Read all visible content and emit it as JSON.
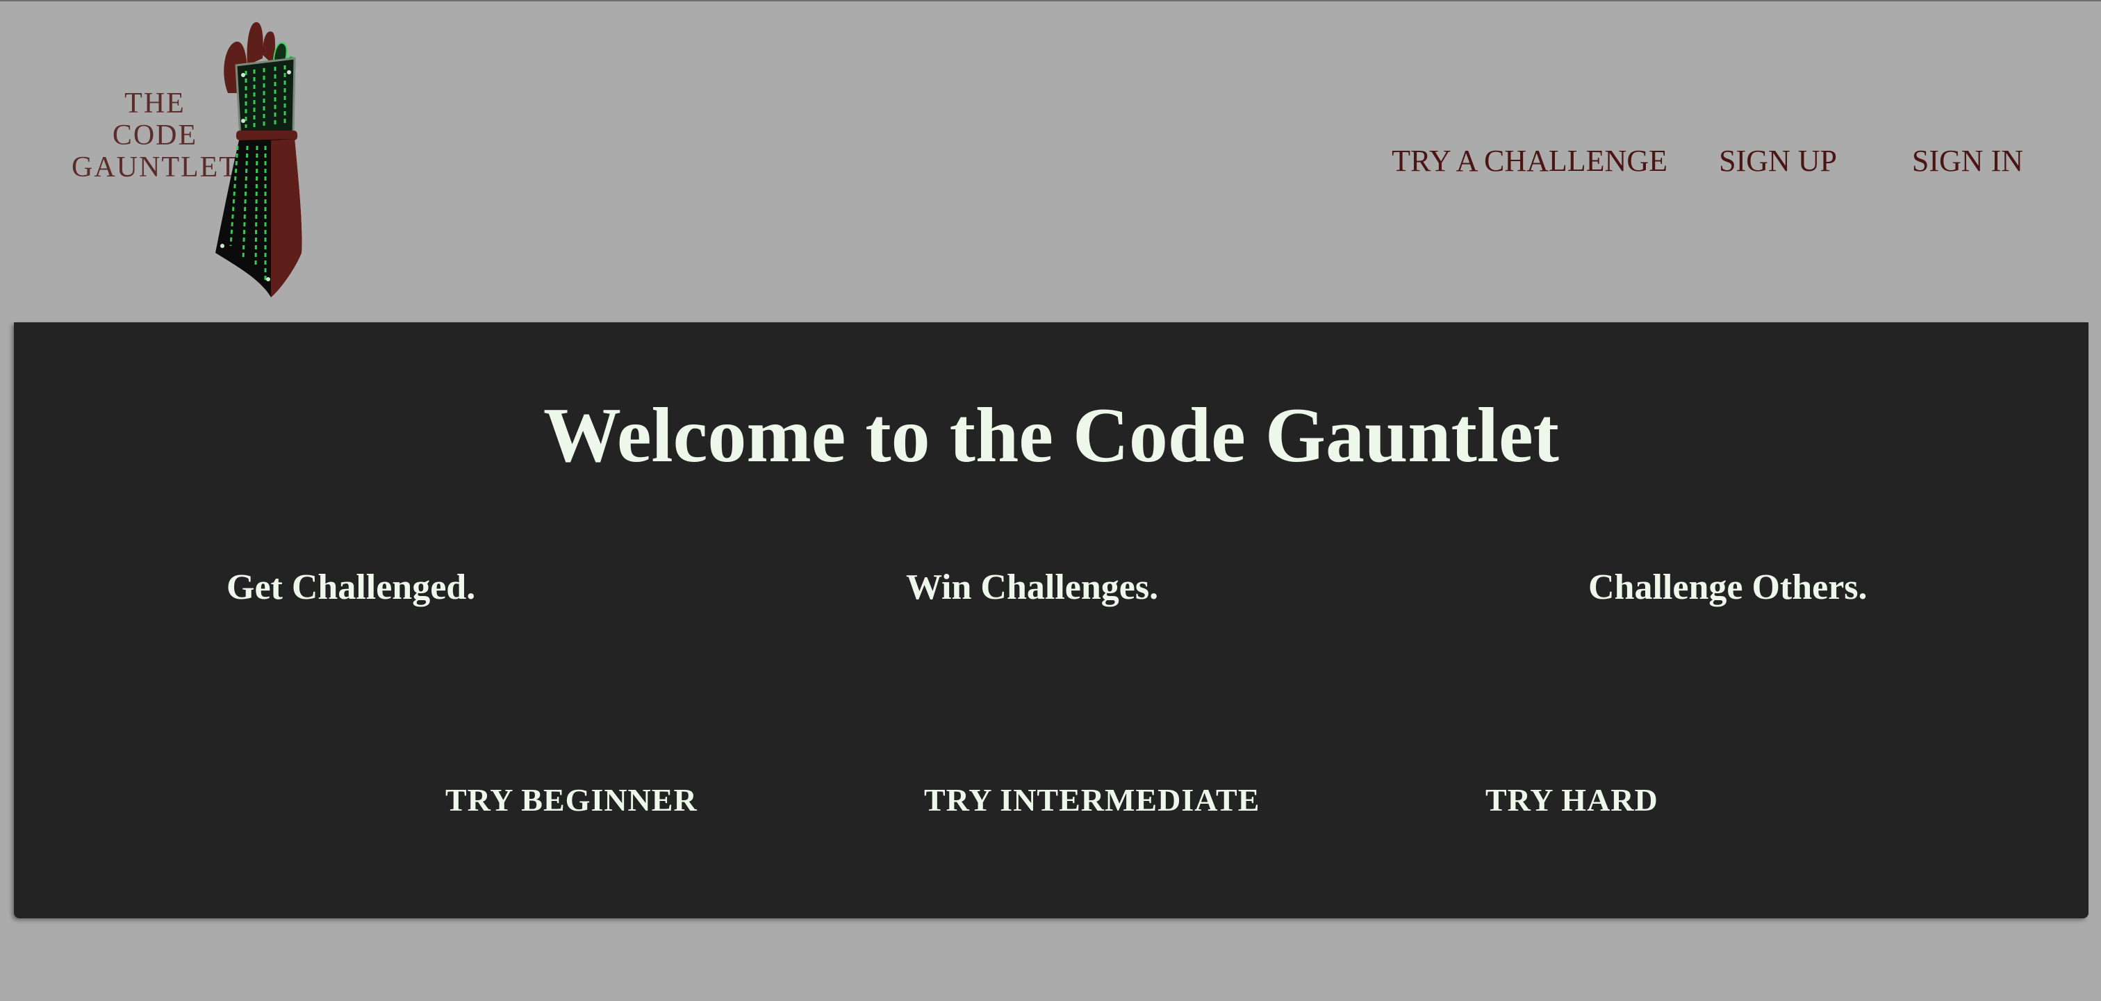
{
  "header": {
    "logo": {
      "line1": "THE",
      "line2": "CODE",
      "line3": "GAUNTLET",
      "icon": "gauntlet-icon"
    },
    "nav": {
      "try_challenge": "TRY A CHALLENGE",
      "sign_up": "SIGN UP",
      "sign_in": "SIGN IN"
    }
  },
  "hero": {
    "title": "Welcome to the Code Gauntlet",
    "taglines": {
      "get": "Get Challenged.",
      "win": "Win Challenges.",
      "others": "Challenge Others."
    },
    "buttons": {
      "beginner": "TRY BEGINNER",
      "intermediate": "TRY INTERMEDIATE",
      "hard": "TRY HARD"
    }
  },
  "colors": {
    "page_background": "#ababab",
    "hero_background": "#232324",
    "hero_text": "#eef8ea",
    "nav_text": "#4a1512",
    "logo_text": "#5a2d2b",
    "gauntlet_brown": "#5e1f1b",
    "matrix_green": "#3bd35a"
  }
}
